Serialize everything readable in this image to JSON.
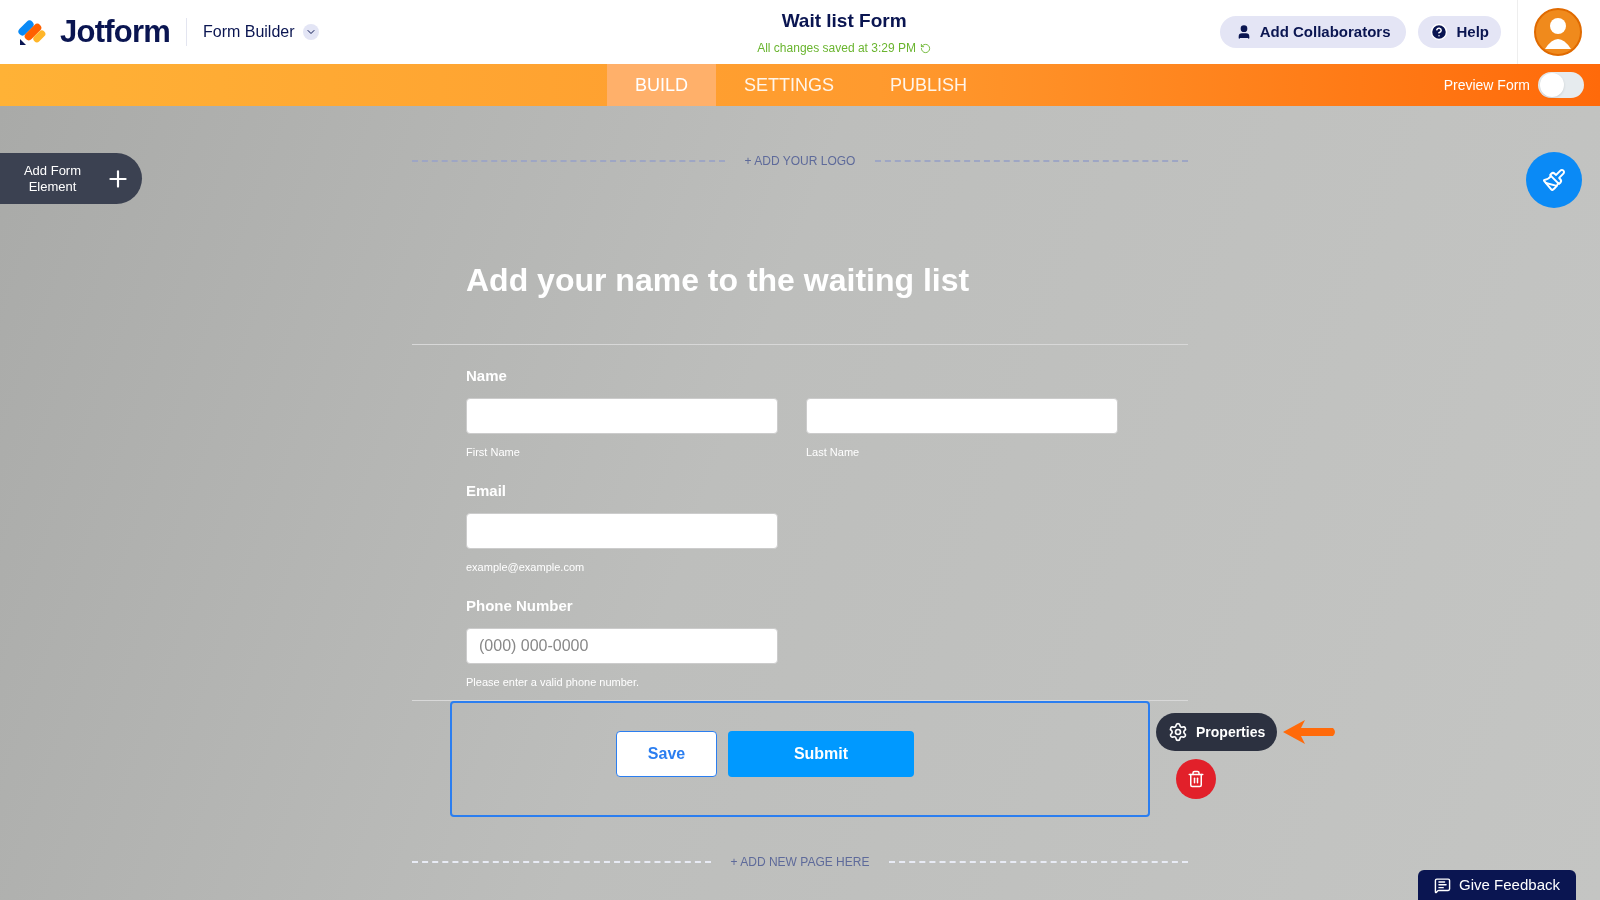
{
  "header": {
    "brand": "Jotform",
    "builder_menu": "Form Builder",
    "form_title": "Wait list Form",
    "save_status": "All changes saved at 3:29 PM",
    "collaborators_button": "Add Collaborators",
    "help_button": "Help"
  },
  "tabs": [
    {
      "label": "BUILD",
      "selected": true
    },
    {
      "label": "SETTINGS",
      "selected": false
    },
    {
      "label": "PUBLISH",
      "selected": false
    }
  ],
  "preview": {
    "label": "Preview Form",
    "on": false
  },
  "add_element": "Add Form Element",
  "form": {
    "logo_prompt": "+ ADD YOUR LOGO",
    "heading": "Add your name to the waiting list",
    "fields": [
      {
        "kind": "name",
        "label": "Name",
        "sublabels": [
          "First Name",
          "Last Name"
        ]
      },
      {
        "kind": "single",
        "label": "Email",
        "sublabel": "example@example.com"
      },
      {
        "kind": "single",
        "label": "Phone Number",
        "placeholder": "(000) 000-0000",
        "sublabel": "Please enter a valid phone number."
      }
    ],
    "buttons": [
      {
        "label": "Save",
        "kind": "secondary"
      },
      {
        "label": "Submit",
        "kind": "primary"
      }
    ],
    "properties": "Properties",
    "new_page_prompt": "+ ADD NEW PAGE HERE"
  },
  "feedback_button": "Give Feedback"
}
